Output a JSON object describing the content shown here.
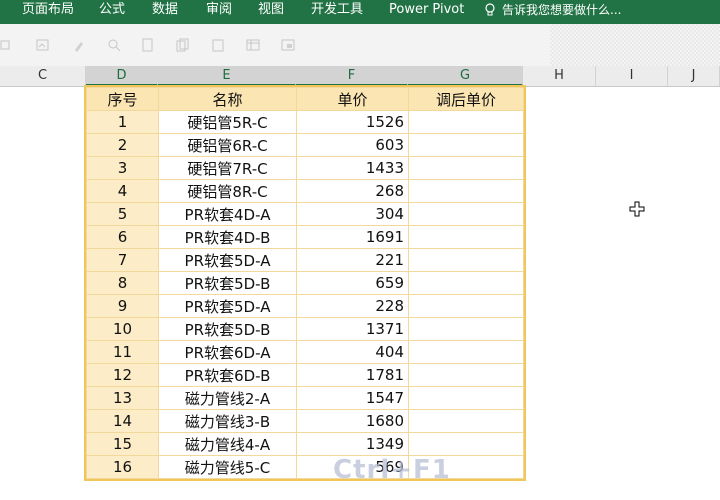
{
  "ribbon": {
    "tabs": [
      "页面布局",
      "公式",
      "数据",
      "审阅",
      "视图",
      "开发工具",
      "Power Pivot"
    ],
    "tell_me": "告诉我您想要做什么..."
  },
  "columns": [
    "C",
    "D",
    "E",
    "F",
    "G",
    "H",
    "I",
    "J"
  ],
  "table": {
    "headers": [
      "序号",
      "名称",
      "单价",
      "调后单价"
    ],
    "rows": [
      {
        "seq": "1",
        "name": "硬铝管5R-C",
        "price": "1526",
        "adjusted": ""
      },
      {
        "seq": "2",
        "name": "硬铝管6R-C",
        "price": "603",
        "adjusted": ""
      },
      {
        "seq": "3",
        "name": "硬铝管7R-C",
        "price": "1433",
        "adjusted": ""
      },
      {
        "seq": "4",
        "name": "硬铝管8R-C",
        "price": "268",
        "adjusted": ""
      },
      {
        "seq": "5",
        "name": "PR软套4D-A",
        "price": "304",
        "adjusted": ""
      },
      {
        "seq": "6",
        "name": "PR软套4D-B",
        "price": "1691",
        "adjusted": ""
      },
      {
        "seq": "7",
        "name": "PR软套5D-A",
        "price": "221",
        "adjusted": ""
      },
      {
        "seq": "8",
        "name": "PR软套5D-B",
        "price": "659",
        "adjusted": ""
      },
      {
        "seq": "9",
        "name": "PR软套5D-A",
        "price": "228",
        "adjusted": ""
      },
      {
        "seq": "10",
        "name": "PR软套5D-B",
        "price": "1371",
        "adjusted": ""
      },
      {
        "seq": "11",
        "name": "PR软套6D-A",
        "price": "404",
        "adjusted": ""
      },
      {
        "seq": "12",
        "name": "PR软套6D-B",
        "price": "1781",
        "adjusted": ""
      },
      {
        "seq": "13",
        "name": "磁力管线2-A",
        "price": "1547",
        "adjusted": ""
      },
      {
        "seq": "14",
        "name": "磁力管线3-B",
        "price": "1680",
        "adjusted": ""
      },
      {
        "seq": "15",
        "name": "磁力管线4-A",
        "price": "1349",
        "adjusted": ""
      },
      {
        "seq": "16",
        "name": "磁力管线5-C",
        "price": "569",
        "adjusted": ""
      }
    ]
  },
  "overlay": {
    "shortcut": "Ctrl+F1"
  },
  "colors": {
    "ribbon": "#217346",
    "table_border": "#f2d99b",
    "header_fill": "#fbe5b3"
  }
}
